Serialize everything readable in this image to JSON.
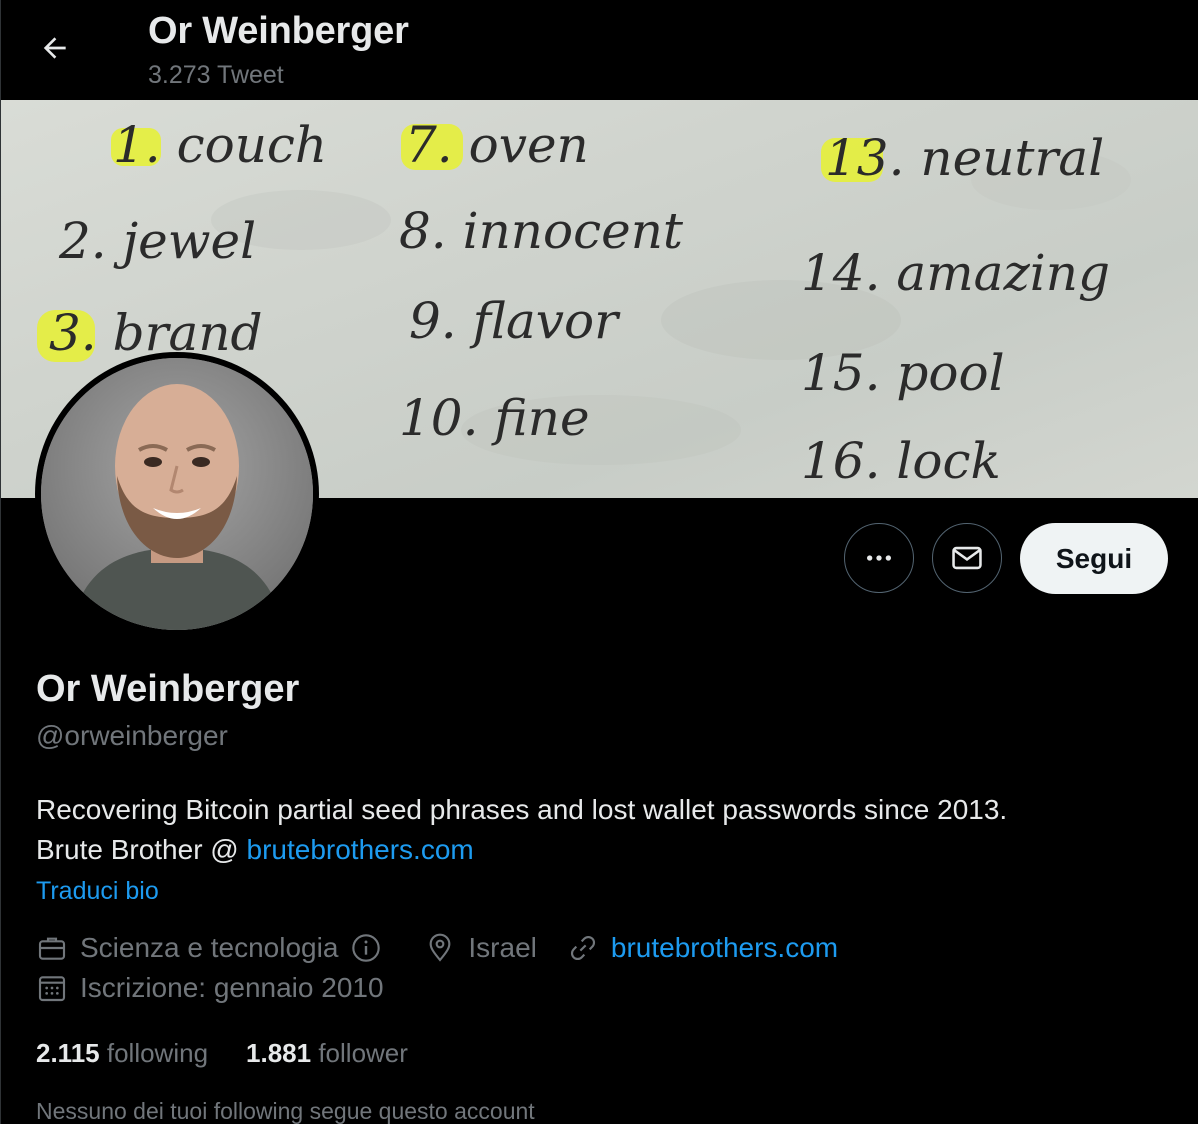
{
  "header": {
    "back_icon": "arrow-left-icon",
    "name": "Or Weinberger",
    "tweet_count": "3.273 Tweet"
  },
  "banner": {
    "words": [
      "1. couch",
      "2. jewel",
      "3. brand",
      "7. oven",
      "8. innocent",
      "9. flavor",
      "10. fine",
      "13. neutral",
      "14. amazing",
      "15. pool",
      "16. lock"
    ],
    "highlight_color": "#e6f03a"
  },
  "actions": {
    "more_icon": "more-horizontal-icon",
    "message_icon": "envelope-icon",
    "follow_label": "Segui"
  },
  "profile": {
    "name": "Or Weinberger",
    "handle": "@orweinberger",
    "bio_line1": "Recovering Bitcoin partial seed phrases and lost wallet passwords since 2013.",
    "bio_line2_prefix": "Brute Brother @ ",
    "bio_link": "brutebrothers.com",
    "translate_label": "Traduci bio",
    "category": "Scienza e tecnologia",
    "location": "Israel",
    "website": "brutebrothers.com",
    "joined": "Iscrizione: gennaio 2010"
  },
  "stats": {
    "following_count": "2.115",
    "following_label": "following",
    "followers_count": "1.881",
    "followers_label": "follower"
  },
  "followed_by_note": "Nessuno dei tuoi following segue questo account",
  "colors": {
    "accent": "#1d9bf0",
    "secondary_text": "#71767b",
    "primary_text": "#e7e9ea",
    "background": "#000000"
  }
}
